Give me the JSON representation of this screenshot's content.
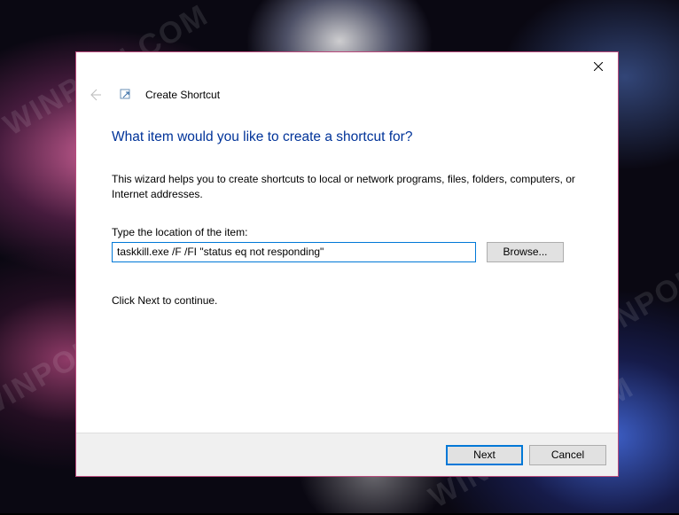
{
  "watermark": "WINPOIN.COM",
  "window": {
    "app_title": "Create Shortcut",
    "question": "What item would you like to create a shortcut for?",
    "helper_text": "This wizard helps you to create shortcuts to local or network programs, files, folders, computers, or Internet addresses.",
    "field_label": "Type the location of the item:",
    "location_value": "taskkill.exe /F /FI \"status eq not responding\"",
    "browse_label": "Browse...",
    "continue_text": "Click Next to continue.",
    "next_label": "Next",
    "cancel_label": "Cancel"
  }
}
